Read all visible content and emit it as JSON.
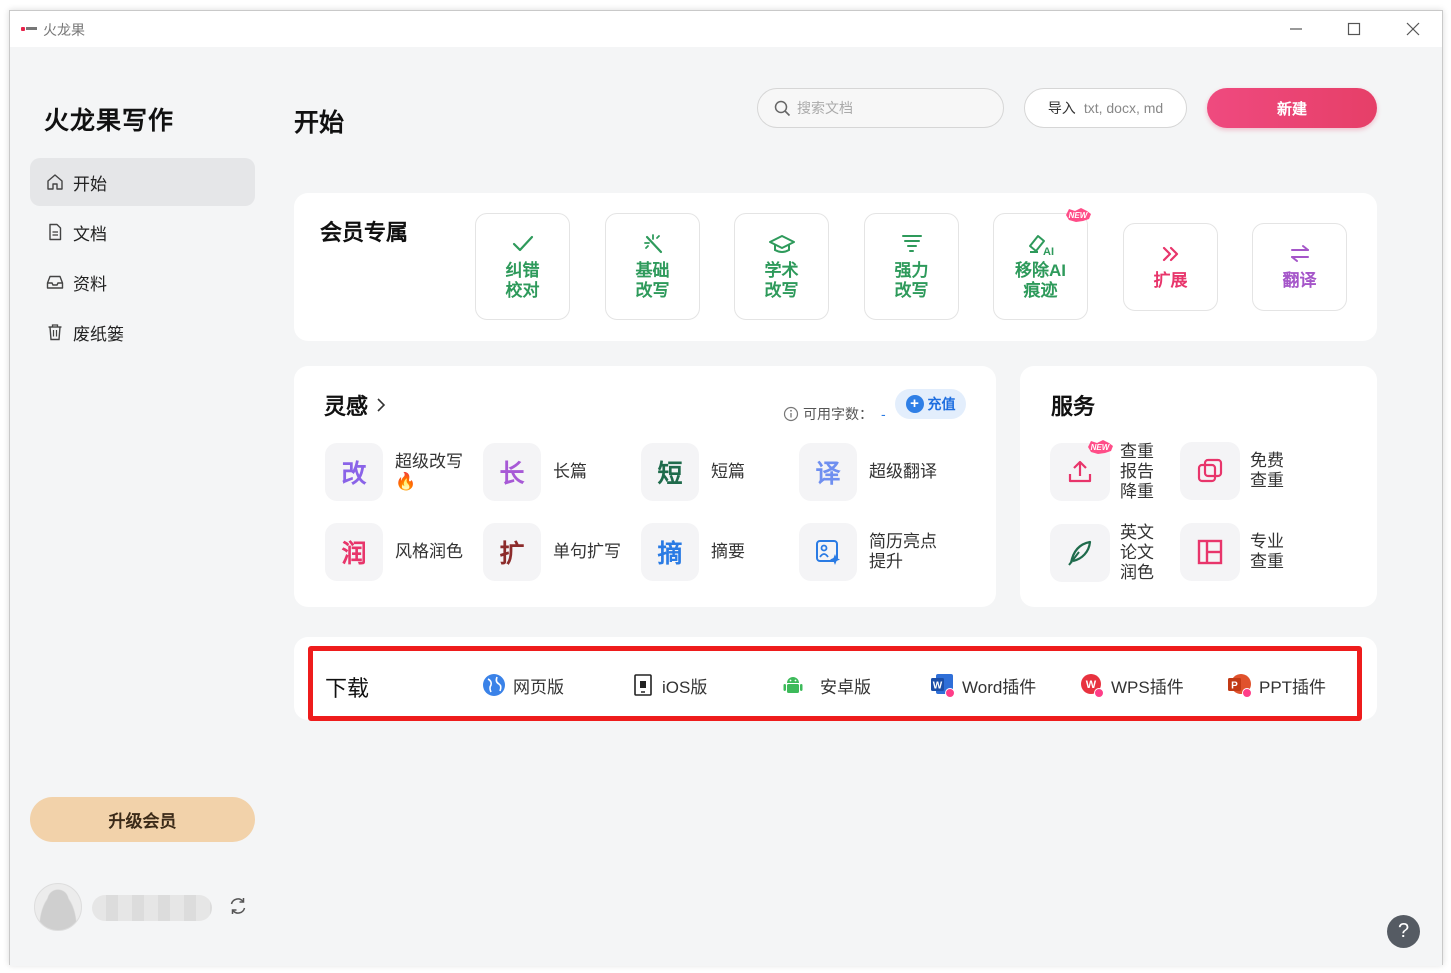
{
  "window": {
    "title": "火龙果",
    "minimize": "—",
    "maximize": "☐",
    "close": "✕"
  },
  "sidebar": {
    "logo": "火龙果写作",
    "items": [
      {
        "label": "开始",
        "icon": "home-icon",
        "active": true
      },
      {
        "label": "文档",
        "icon": "document-icon"
      },
      {
        "label": "资料",
        "icon": "inbox-icon"
      },
      {
        "label": "废纸篓",
        "icon": "trash-icon"
      }
    ],
    "upgrade_label": "升级会员"
  },
  "header": {
    "title": "开始",
    "search_placeholder": "搜索文档",
    "import_label": "导入",
    "import_formats": "txt, docx, md",
    "new_label": "新建"
  },
  "member": {
    "title": "会员专属",
    "tools": [
      {
        "label": "纠错校对",
        "icon": "check-icon"
      },
      {
        "label": "基础改写",
        "icon": "magic-wand-icon"
      },
      {
        "label": "学术改写",
        "icon": "graduation-cap-icon"
      },
      {
        "label": "强力改写",
        "icon": "tornado-icon"
      },
      {
        "label": "移除AI痕迹",
        "icon": "eraser-ai-icon",
        "badge": "NEW"
      },
      {
        "label": "扩展",
        "icon": "double-chevron-right-icon"
      },
      {
        "label": "翻译",
        "icon": "swap-arrows-icon"
      }
    ]
  },
  "inspiration": {
    "title": "灵感",
    "quota_label": "可用字数：",
    "quota_value": "-",
    "recharge_label": "充值",
    "items": [
      {
        "glyph": "改",
        "label": "超级改写",
        "emoji": "🔥",
        "color": "#8a63e8"
      },
      {
        "glyph": "长",
        "label": "长篇",
        "color": "#a759d6"
      },
      {
        "glyph": "短",
        "label": "短篇",
        "color": "#1f6b4c"
      },
      {
        "glyph": "译",
        "label": "超级翻译",
        "color": "#6f8ff0"
      },
      {
        "glyph": "润",
        "label": "风格润色",
        "color": "#e8356b"
      },
      {
        "glyph": "扩",
        "label": "单句扩写",
        "color": "#8c2b2b"
      },
      {
        "glyph": "摘",
        "label": "摘要",
        "color": "#2a7be4"
      },
      {
        "glyph": "",
        "label": "简历亮点提升",
        "color": "#2a7be4"
      }
    ]
  },
  "services": {
    "title": "服务",
    "items": [
      {
        "label": "查重报告降重",
        "icon": "upload-icon",
        "badge": "NEW"
      },
      {
        "label": "免费查重",
        "icon": "copy-squares-icon"
      },
      {
        "label": "英文论文润色",
        "icon": "quill-pen-icon"
      },
      {
        "label": "专业查重",
        "icon": "layout-grid-icon"
      }
    ]
  },
  "download": {
    "title": "下载",
    "items": [
      {
        "label": "网页版",
        "icon": "globe-icon"
      },
      {
        "label": "iOS版",
        "icon": "phone-icon"
      },
      {
        "label": "安卓版",
        "icon": "android-icon"
      },
      {
        "label": "Word插件",
        "icon": "word-icon"
      },
      {
        "label": "WPS插件",
        "icon": "wps-icon"
      },
      {
        "label": "PPT插件",
        "icon": "powerpoint-icon"
      }
    ]
  },
  "help_label": "?",
  "colors": {
    "accent": "#e63f68",
    "green": "#2e9a5b",
    "highlight": "#ee1c1c"
  }
}
